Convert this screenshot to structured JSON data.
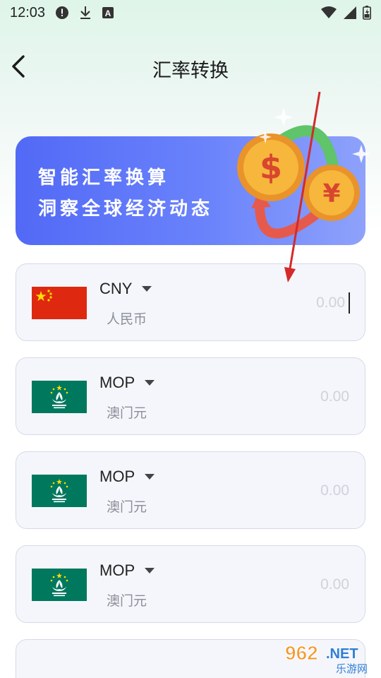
{
  "status_bar": {
    "time": "12:03",
    "icons": [
      "alert-icon",
      "download-icon",
      "a-notification-icon"
    ],
    "right_icons": [
      "wifi-icon",
      "signal-icon",
      "battery-icon"
    ]
  },
  "header": {
    "title": "汇率转换",
    "back_icon": "back-arrow-icon"
  },
  "banner": {
    "line1": "智能汇率换算",
    "line2": "洞察全球经济动态",
    "art": "coins-exchange-icon",
    "gradient": [
      "#5269f6",
      "#8ea2fb"
    ]
  },
  "currencies": [
    {
      "code": "CNY",
      "name": "人民币",
      "flag": "china-flag",
      "amount_placeholder": "0.00",
      "focused": true
    },
    {
      "code": "MOP",
      "name": "澳门元",
      "flag": "macau-flag",
      "amount_placeholder": "0.00",
      "focused": false
    },
    {
      "code": "MOP",
      "name": "澳门元",
      "flag": "macau-flag",
      "amount_placeholder": "0.00",
      "focused": false
    },
    {
      "code": "MOP",
      "name": "澳门元",
      "flag": "macau-flag",
      "amount_placeholder": "0.00",
      "focused": false
    }
  ],
  "colors": {
    "accent": "#5269f6",
    "card_bg": "#f5f6fb",
    "card_border": "#d6dae8",
    "china_red": "#de2910",
    "china_star": "#ffde00",
    "macau_green": "#00785e",
    "annotation_red": "#d42a2a"
  },
  "watermark": {
    "text": "962.NET",
    "subtext": "乐游网"
  }
}
